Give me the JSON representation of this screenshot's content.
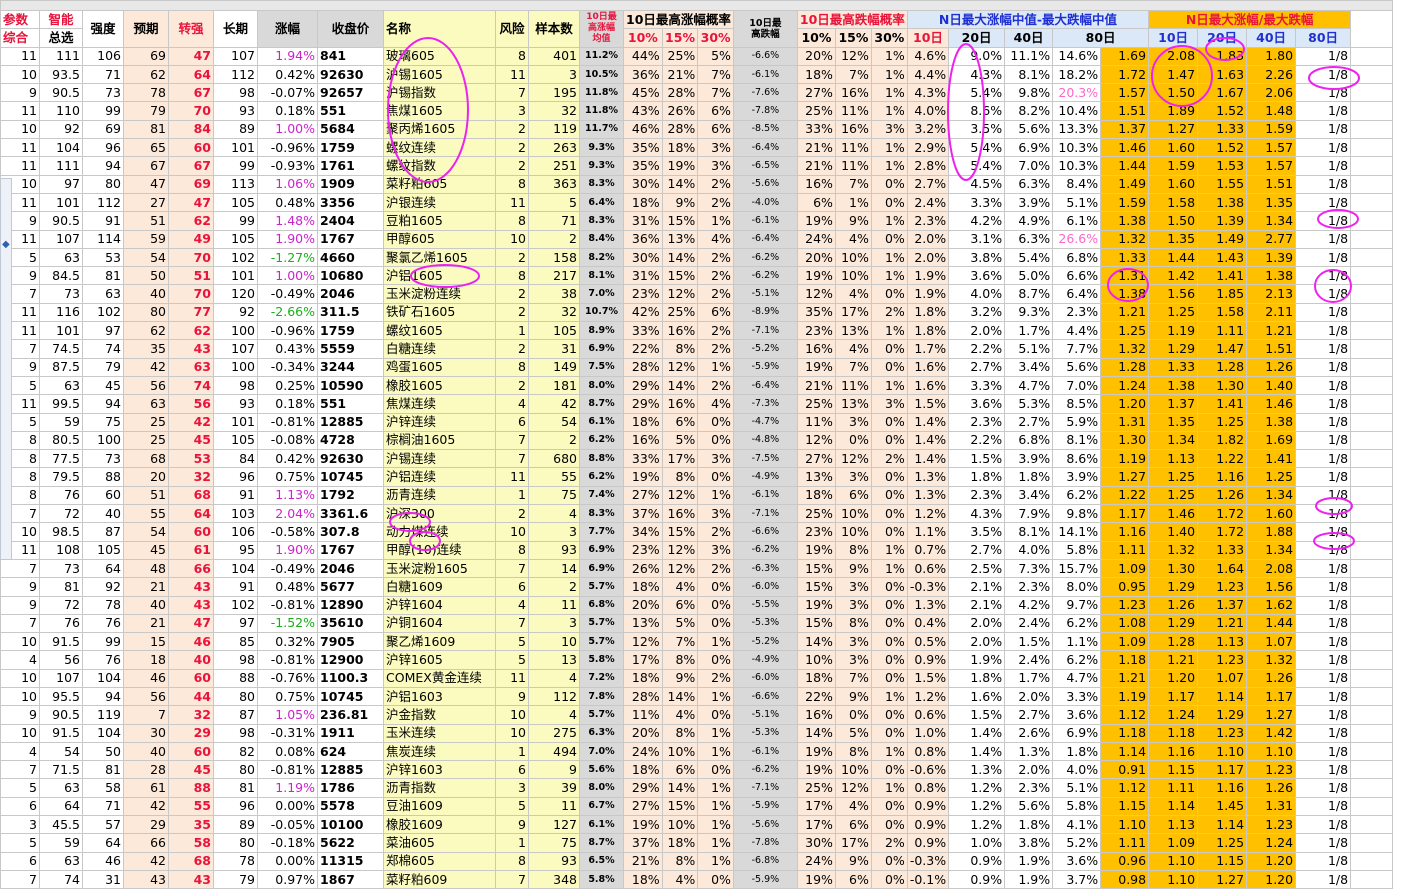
{
  "header": {
    "group_labels": [
      "参数",
      "智能"
    ],
    "sub_labels": [
      "综合",
      "总选"
    ],
    "cols": [
      "强度",
      "预期",
      "转强",
      "长期",
      "涨幅",
      "收盘价",
      "名称",
      "风险",
      "样本数"
    ],
    "median_top": "10日最高涨幅",
    "median_bottom": "均值",
    "prob_up_title": "10日最高涨幅概率",
    "low_median_top": "10日最",
    "low_median_bottom": "高跌幅",
    "prob_down_title": "10日最高跌幅概率",
    "range_title": "N日最大涨幅中值-最大跌幅中值",
    "ratio_title": "N日最大涨幅/最大跌幅",
    "p10": "10%",
    "p15": "15%",
    "p30": "30%",
    "d10": "10日",
    "d20": "20日",
    "d40": "40日",
    "d80": "80日"
  },
  "rows": [
    [
      "11",
      "111",
      "106",
      "69",
      "47",
      "107",
      "1.94%",
      "841",
      "玻璃605",
      "8",
      "401",
      "11.2%",
      "44%",
      "25%",
      "5%",
      "-6.6%",
      "20%",
      "12%",
      "1%",
      "4.6%",
      "9.0%",
      "11.1%",
      "14.6%",
      "1.69",
      "2.08",
      "1.83",
      "1.80",
      "1/8"
    ],
    [
      "10",
      "93.5",
      "71",
      "62",
      "64",
      "112",
      "0.42%",
      "92630",
      "沪锡1605",
      "11",
      "3",
      "10.5%",
      "36%",
      "21%",
      "7%",
      "-6.1%",
      "18%",
      "7%",
      "1%",
      "4.4%",
      "4.3%",
      "8.1%",
      "18.2%",
      "1.72",
      "1.47",
      "1.63",
      "2.26",
      "1/8"
    ],
    [
      "9",
      "90.5",
      "73",
      "78",
      "67",
      "98",
      "-0.07%",
      "92657",
      "沪锡指数",
      "7",
      "195",
      "11.8%",
      "45%",
      "28%",
      "7%",
      "-7.6%",
      "27%",
      "16%",
      "1%",
      "4.3%",
      "5.4%",
      "9.8%",
      "20.3%",
      "1.57",
      "1.50",
      "1.67",
      "2.06",
      "1/8"
    ],
    [
      "11",
      "110",
      "99",
      "79",
      "70",
      "93",
      "0.18%",
      "551",
      "焦煤1605",
      "3",
      "32",
      "11.8%",
      "43%",
      "26%",
      "6%",
      "-7.8%",
      "25%",
      "11%",
      "1%",
      "4.0%",
      "8.6%",
      "8.2%",
      "10.4%",
      "1.51",
      "1.89",
      "1.52",
      "1.48",
      "1/8"
    ],
    [
      "10",
      "92",
      "69",
      "81",
      "84",
      "89",
      "1.00%",
      "5684",
      "聚丙烯1605",
      "2",
      "119",
      "11.7%",
      "46%",
      "28%",
      "6%",
      "-8.5%",
      "33%",
      "16%",
      "3%",
      "3.2%",
      "3.5%",
      "5.6%",
      "13.3%",
      "1.37",
      "1.27",
      "1.33",
      "1.59",
      "1/8"
    ],
    [
      "11",
      "104",
      "96",
      "65",
      "60",
      "101",
      "-0.96%",
      "1759",
      "螺纹连续",
      "2",
      "263",
      "9.3%",
      "35%",
      "18%",
      "3%",
      "-6.4%",
      "21%",
      "11%",
      "1%",
      "2.9%",
      "5.4%",
      "6.9%",
      "10.3%",
      "1.46",
      "1.60",
      "1.52",
      "1.57",
      "1/8"
    ],
    [
      "11",
      "111",
      "94",
      "67",
      "67",
      "99",
      "-0.93%",
      "1761",
      "螺纹指数",
      "2",
      "251",
      "9.3%",
      "35%",
      "19%",
      "3%",
      "-6.5%",
      "21%",
      "11%",
      "1%",
      "2.8%",
      "5.4%",
      "7.0%",
      "10.3%",
      "1.44",
      "1.59",
      "1.53",
      "1.57",
      "1/8"
    ],
    [
      "10",
      "97",
      "80",
      "47",
      "69",
      "113",
      "1.06%",
      "1909",
      "菜籽粕605",
      "8",
      "363",
      "8.3%",
      "30%",
      "14%",
      "2%",
      "-5.6%",
      "16%",
      "7%",
      "0%",
      "2.7%",
      "4.5%",
      "6.3%",
      "8.4%",
      "1.49",
      "1.60",
      "1.55",
      "1.51",
      "1/8"
    ],
    [
      "11",
      "101",
      "112",
      "27",
      "47",
      "105",
      "0.48%",
      "3356",
      "沪银连续",
      "11",
      "5",
      "6.4%",
      "18%",
      "9%",
      "2%",
      "-4.0%",
      "6%",
      "1%",
      "0%",
      "2.4%",
      "3.3%",
      "3.9%",
      "5.1%",
      "1.59",
      "1.58",
      "1.38",
      "1.35",
      "1/8"
    ],
    [
      "9",
      "90.5",
      "91",
      "51",
      "62",
      "99",
      "1.48%",
      "2404",
      "豆粕1605",
      "8",
      "71",
      "8.3%",
      "31%",
      "15%",
      "1%",
      "-6.1%",
      "19%",
      "9%",
      "1%",
      "2.3%",
      "4.2%",
      "4.9%",
      "6.1%",
      "1.38",
      "1.50",
      "1.39",
      "1.34",
      "1/8"
    ],
    [
      "11",
      "107",
      "114",
      "59",
      "49",
      "105",
      "1.90%",
      "1767",
      "甲醇605",
      "10",
      "2",
      "8.4%",
      "36%",
      "13%",
      "4%",
      "-6.4%",
      "24%",
      "4%",
      "0%",
      "2.0%",
      "3.1%",
      "6.3%",
      "26.6%",
      "1.32",
      "1.35",
      "1.49",
      "2.77",
      "1/8"
    ],
    [
      "5",
      "63",
      "53",
      "54",
      "70",
      "102",
      "-1.27%",
      "4660",
      "聚氯乙烯1605",
      "2",
      "158",
      "8.2%",
      "30%",
      "14%",
      "2%",
      "-6.2%",
      "20%",
      "10%",
      "1%",
      "2.0%",
      "3.8%",
      "5.4%",
      "6.8%",
      "1.33",
      "1.44",
      "1.43",
      "1.39",
      "1/8"
    ],
    [
      "9",
      "84.5",
      "81",
      "50",
      "101",
      "10680",
      "沪铝1605",
      "8",
      "217",
      "8.1%",
      "31%",
      "15%",
      "2%",
      "-6.2%",
      "19%",
      "10%",
      "1%",
      "1.9%",
      "3.6%",
      "5.0%",
      "6.6%",
      "1.31",
      "1.42",
      "1.41",
      "1.38",
      "1/8",
      "",
      "",
      "",
      "",
      "",
      ""
    ],
    [
      "7",
      "73",
      "63",
      "40",
      "70",
      "120",
      "-0.49%",
      "2046",
      "玉米淀粉连续",
      "2",
      "38",
      "7.0%",
      "23%",
      "12%",
      "2%",
      "-5.1%",
      "12%",
      "4%",
      "0%",
      "1.9%",
      "4.0%",
      "8.7%",
      "6.4%",
      "1.38",
      "1.56",
      "1.85",
      "2.13",
      "1/8"
    ],
    [
      "11",
      "116",
      "102",
      "80",
      "77",
      "92",
      "-2.66%",
      "311.5",
      "铁矿石1605",
      "2",
      "32",
      "10.7%",
      "42%",
      "25%",
      "6%",
      "-8.9%",
      "35%",
      "17%",
      "2%",
      "1.8%",
      "3.2%",
      "9.3%",
      "2.3%",
      "1.21",
      "1.25",
      "1.58",
      "2.11",
      "1/8"
    ],
    [
      "11",
      "101",
      "97",
      "62",
      "62",
      "100",
      "-0.96%",
      "1759",
      "螺纹1605",
      "1",
      "105",
      "8.9%",
      "33%",
      "16%",
      "2%",
      "-7.1%",
      "23%",
      "13%",
      "1%",
      "1.8%",
      "2.0%",
      "1.7%",
      "4.4%",
      "1.25",
      "1.19",
      "1.11",
      "1.21",
      "1/8"
    ],
    [
      "7",
      "74.5",
      "74",
      "35",
      "43",
      "107",
      "0.43%",
      "5559",
      "白糖连续",
      "2",
      "31",
      "6.9%",
      "22%",
      "8%",
      "2%",
      "-5.2%",
      "16%",
      "4%",
      "0%",
      "1.7%",
      "2.2%",
      "5.1%",
      "7.7%",
      "1.32",
      "1.29",
      "1.47",
      "1.51",
      "1/8"
    ],
    [
      "9",
      "87.5",
      "79",
      "42",
      "63",
      "100",
      "-0.34%",
      "3244",
      "鸡蛋1605",
      "8",
      "149",
      "7.5%",
      "28%",
      "12%",
      "1%",
      "-5.9%",
      "19%",
      "7%",
      "0%",
      "1.6%",
      "2.7%",
      "3.4%",
      "5.6%",
      "1.28",
      "1.33",
      "1.28",
      "1.26",
      "1/8"
    ],
    [
      "5",
      "63",
      "45",
      "56",
      "74",
      "98",
      "0.25%",
      "10590",
      "橡胶1605",
      "2",
      "181",
      "8.0%",
      "29%",
      "14%",
      "2%",
      "-6.4%",
      "21%",
      "11%",
      "1%",
      "1.6%",
      "3.3%",
      "4.7%",
      "7.0%",
      "1.24",
      "1.38",
      "1.30",
      "1.40",
      "1/8"
    ],
    [
      "11",
      "99.5",
      "94",
      "63",
      "56",
      "93",
      "0.18%",
      "551",
      "焦煤连续",
      "4",
      "42",
      "8.7%",
      "29%",
      "16%",
      "4%",
      "-7.3%",
      "25%",
      "13%",
      "3%",
      "1.5%",
      "3.6%",
      "5.3%",
      "8.5%",
      "1.20",
      "1.37",
      "1.41",
      "1.46",
      "1/8"
    ],
    [
      "5",
      "59",
      "75",
      "25",
      "42",
      "101",
      "-0.81%",
      "12885",
      "沪锌连续",
      "6",
      "54",
      "6.1%",
      "18%",
      "6%",
      "0%",
      "-4.7%",
      "11%",
      "3%",
      "0%",
      "1.4%",
      "2.3%",
      "2.7%",
      "5.9%",
      "1.31",
      "1.35",
      "1.25",
      "1.38",
      "1/8"
    ],
    [
      "8",
      "80.5",
      "100",
      "25",
      "45",
      "105",
      "-0.08%",
      "4728",
      "棕榈油1605",
      "7",
      "2",
      "6.2%",
      "16%",
      "5%",
      "0%",
      "-4.8%",
      "12%",
      "0%",
      "0%",
      "1.4%",
      "2.2%",
      "6.8%",
      "8.1%",
      "1.30",
      "1.34",
      "1.82",
      "1.69",
      "1/8"
    ],
    [
      "8",
      "77.5",
      "73",
      "68",
      "53",
      "84",
      "0.42%",
      "92630",
      "沪锡连续",
      "7",
      "680",
      "8.8%",
      "33%",
      "17%",
      "3%",
      "-7.5%",
      "27%",
      "12%",
      "2%",
      "1.4%",
      "1.5%",
      "3.9%",
      "8.6%",
      "1.19",
      "1.13",
      "1.22",
      "1.41",
      "1/8"
    ],
    [
      "8",
      "79.5",
      "88",
      "20",
      "32",
      "96",
      "0.75%",
      "10745",
      "沪铝连续",
      "11",
      "55",
      "6.2%",
      "19%",
      "8%",
      "0%",
      "-4.9%",
      "13%",
      "3%",
      "0%",
      "1.3%",
      "1.8%",
      "1.8%",
      "3.9%",
      "1.27",
      "1.25",
      "1.16",
      "1.25",
      "1/8"
    ],
    [
      "8",
      "76",
      "60",
      "51",
      "68",
      "91",
      "1.13%",
      "1792",
      "沥青连续",
      "1",
      "75",
      "7.4%",
      "27%",
      "12%",
      "1%",
      "-6.1%",
      "18%",
      "6%",
      "0%",
      "1.3%",
      "2.3%",
      "3.4%",
      "6.2%",
      "1.22",
      "1.25",
      "1.26",
      "1.34",
      "1/8"
    ],
    [
      "7",
      "72",
      "40",
      "55",
      "64",
      "103",
      "2.04%",
      "3361.6",
      "沪深300",
      "2",
      "4",
      "8.3%",
      "37%",
      "16%",
      "3%",
      "-7.1%",
      "25%",
      "10%",
      "0%",
      "1.2%",
      "4.3%",
      "7.9%",
      "9.8%",
      "1.17",
      "1.46",
      "1.72",
      "1.60",
      "1/8"
    ],
    [
      "10",
      "98.5",
      "87",
      "54",
      "60",
      "106",
      "-0.58%",
      "307.8",
      "动力煤连续",
      "10",
      "3",
      "7.7%",
      "34%",
      "15%",
      "2%",
      "-6.6%",
      "23%",
      "10%",
      "0%",
      "1.1%",
      "3.5%",
      "8.1%",
      "14.1%",
      "1.16",
      "1.40",
      "1.72",
      "1.88",
      "1/8"
    ],
    [
      "11",
      "108",
      "105",
      "45",
      "61",
      "95",
      "1.90%",
      "1767",
      "甲醇(10)连续",
      "8",
      "93",
      "6.9%",
      "23%",
      "12%",
      "3%",
      "-6.2%",
      "19%",
      "8%",
      "1%",
      "0.7%",
      "2.7%",
      "4.0%",
      "5.8%",
      "1.11",
      "1.32",
      "1.33",
      "1.34",
      "1/8"
    ],
    [
      "7",
      "73",
      "64",
      "48",
      "66",
      "104",
      "-0.49%",
      "2046",
      "玉米淀粉1605",
      "7",
      "14",
      "6.9%",
      "26%",
      "12%",
      "2%",
      "-6.3%",
      "15%",
      "9%",
      "1%",
      "0.6%",
      "2.5%",
      "7.3%",
      "15.7%",
      "1.09",
      "1.30",
      "1.64",
      "2.08",
      "1/8"
    ],
    [
      "9",
      "81",
      "92",
      "21",
      "43",
      "91",
      "0.48%",
      "5677",
      "白糖1609",
      "6",
      "2",
      "5.7%",
      "18%",
      "4%",
      "0%",
      "-6.0%",
      "15%",
      "3%",
      "0%",
      "-0.3%",
      "2.1%",
      "2.3%",
      "8.0%",
      "0.95",
      "1.29",
      "1.23",
      "1.56",
      "1/8"
    ],
    [
      "9",
      "72",
      "78",
      "40",
      "43",
      "102",
      "-0.81%",
      "12890",
      "沪锌1604",
      "4",
      "11",
      "6.8%",
      "20%",
      "6%",
      "0%",
      "-5.5%",
      "19%",
      "3%",
      "0%",
      "1.3%",
      "2.1%",
      "4.2%",
      "9.7%",
      "1.23",
      "1.26",
      "1.37",
      "1.62",
      "1/8"
    ],
    [
      "7",
      "76",
      "76",
      "21",
      "47",
      "97",
      "-1.52%",
      "35610",
      "沪铜1604",
      "7",
      "3",
      "5.7%",
      "13%",
      "5%",
      "0%",
      "-5.3%",
      "15%",
      "8%",
      "0%",
      "0.4%",
      "2.0%",
      "2.4%",
      "6.2%",
      "1.08",
      "1.29",
      "1.21",
      "1.44",
      "1/8"
    ],
    [
      "10",
      "91.5",
      "99",
      "15",
      "46",
      "85",
      "0.32%",
      "7905",
      "聚乙烯1609",
      "5",
      "10",
      "5.7%",
      "12%",
      "7%",
      "1%",
      "-5.2%",
      "14%",
      "3%",
      "0%",
      "0.5%",
      "2.0%",
      "1.5%",
      "1.1%",
      "1.09",
      "1.28",
      "1.13",
      "1.07",
      "1/8"
    ],
    [
      "4",
      "56",
      "76",
      "18",
      "40",
      "98",
      "-0.81%",
      "12900",
      "沪锌1605",
      "5",
      "13",
      "5.8%",
      "17%",
      "8%",
      "0%",
      "-4.9%",
      "10%",
      "3%",
      "0%",
      "0.9%",
      "1.9%",
      "2.4%",
      "6.2%",
      "1.18",
      "1.21",
      "1.23",
      "1.32",
      "1/8"
    ],
    [
      "10",
      "107",
      "104",
      "46",
      "60",
      "88",
      "-0.76%",
      "1100.3",
      "COMEX黄金连续",
      "11",
      "4",
      "7.2%",
      "18%",
      "9%",
      "2%",
      "-6.0%",
      "18%",
      "7%",
      "0%",
      "1.5%",
      "1.8%",
      "1.7%",
      "4.7%",
      "1.21",
      "1.20",
      "1.07",
      "1.26",
      "1/8"
    ],
    [
      "10",
      "95.5",
      "94",
      "56",
      "44",
      "80",
      "0.75%",
      "10745",
      "沪铝1603",
      "9",
      "112",
      "7.8%",
      "28%",
      "14%",
      "1%",
      "-6.6%",
      "22%",
      "9%",
      "1%",
      "1.2%",
      "1.6%",
      "2.0%",
      "3.3%",
      "1.19",
      "1.17",
      "1.14",
      "1.17",
      "1/8"
    ],
    [
      "9",
      "90.5",
      "119",
      "7",
      "32",
      "87",
      "1.05%",
      "236.81",
      "沪金指数",
      "10",
      "4",
      "5.7%",
      "11%",
      "4%",
      "0%",
      "-5.1%",
      "16%",
      "0%",
      "0%",
      "0.6%",
      "1.5%",
      "2.7%",
      "3.6%",
      "1.12",
      "1.24",
      "1.29",
      "1.27",
      "1/8"
    ],
    [
      "10",
      "91.5",
      "104",
      "30",
      "29",
      "98",
      "-0.31%",
      "1911",
      "玉米连续",
      "10",
      "275",
      "6.3%",
      "20%",
      "8%",
      "1%",
      "-5.3%",
      "14%",
      "5%",
      "0%",
      "1.0%",
      "1.4%",
      "2.6%",
      "6.9%",
      "1.18",
      "1.18",
      "1.23",
      "1.42",
      "1/8"
    ],
    [
      "4",
      "54",
      "50",
      "40",
      "60",
      "82",
      "0.08%",
      "624",
      "焦炭连续",
      "1",
      "494",
      "7.0%",
      "24%",
      "10%",
      "1%",
      "-6.1%",
      "19%",
      "8%",
      "1%",
      "0.8%",
      "1.4%",
      "1.3%",
      "1.8%",
      "1.14",
      "1.16",
      "1.10",
      "1.10",
      "1/8"
    ],
    [
      "7",
      "71.5",
      "81",
      "28",
      "45",
      "80",
      "-0.81%",
      "12885",
      "沪锌1603",
      "6",
      "9",
      "5.6%",
      "18%",
      "6%",
      "0%",
      "-6.2%",
      "19%",
      "10%",
      "0%",
      "-0.6%",
      "1.3%",
      "2.0%",
      "4.0%",
      "0.91",
      "1.15",
      "1.17",
      "1.23",
      "1/8"
    ],
    [
      "5",
      "63",
      "58",
      "61",
      "88",
      "81",
      "1.19%",
      "1786",
      "沥青指数",
      "3",
      "39",
      "8.0%",
      "29%",
      "14%",
      "1%",
      "-7.1%",
      "25%",
      "12%",
      "1%",
      "0.8%",
      "1.2%",
      "2.3%",
      "5.1%",
      "1.12",
      "1.11",
      "1.16",
      "1.26",
      "1/8"
    ],
    [
      "6",
      "64",
      "71",
      "42",
      "55",
      "96",
      "0.00%",
      "5578",
      "豆油1609",
      "5",
      "11",
      "6.7%",
      "27%",
      "15%",
      "1%",
      "-5.9%",
      "17%",
      "4%",
      "0%",
      "0.9%",
      "1.2%",
      "5.6%",
      "5.8%",
      "1.15",
      "1.14",
      "1.45",
      "1.31",
      "1/8"
    ],
    [
      "3",
      "45.5",
      "57",
      "29",
      "35",
      "89",
      "-0.05%",
      "10100",
      "橡胶1609",
      "9",
      "127",
      "6.1%",
      "19%",
      "10%",
      "1%",
      "-5.6%",
      "17%",
      "6%",
      "0%",
      "0.9%",
      "1.2%",
      "1.8%",
      "4.1%",
      "1.10",
      "1.13",
      "1.14",
      "1.23",
      "1/8"
    ],
    [
      "5",
      "59",
      "64",
      "66",
      "58",
      "80",
      "-0.18%",
      "5622",
      "菜油605",
      "1",
      "75",
      "8.7%",
      "37%",
      "18%",
      "1%",
      "-7.8%",
      "30%",
      "17%",
      "2%",
      "0.9%",
      "1.0%",
      "3.8%",
      "5.2%",
      "1.11",
      "1.09",
      "1.25",
      "1.24",
      "1/8"
    ],
    [
      "6",
      "63",
      "46",
      "42",
      "68",
      "78",
      "0.00%",
      "11315",
      "郑棉605",
      "8",
      "93",
      "6.5%",
      "21%",
      "8%",
      "1%",
      "-6.8%",
      "24%",
      "9%",
      "0%",
      "-0.3%",
      "0.9%",
      "1.9%",
      "3.6%",
      "0.96",
      "1.10",
      "1.15",
      "1.20",
      "1/8"
    ],
    [
      "7",
      "74",
      "31",
      "43",
      "43",
      "79",
      "0.97%",
      "1867",
      "菜籽粕609",
      "7",
      "348",
      "5.8%",
      "18%",
      "4%",
      "0%",
      "-5.9%",
      "19%",
      "6%",
      "0%",
      "-0.1%",
      "0.9%",
      "1.9%",
      "3.7%",
      "0.98",
      "1.10",
      "1.27",
      "1.20",
      "1/8"
    ]
  ]
}
